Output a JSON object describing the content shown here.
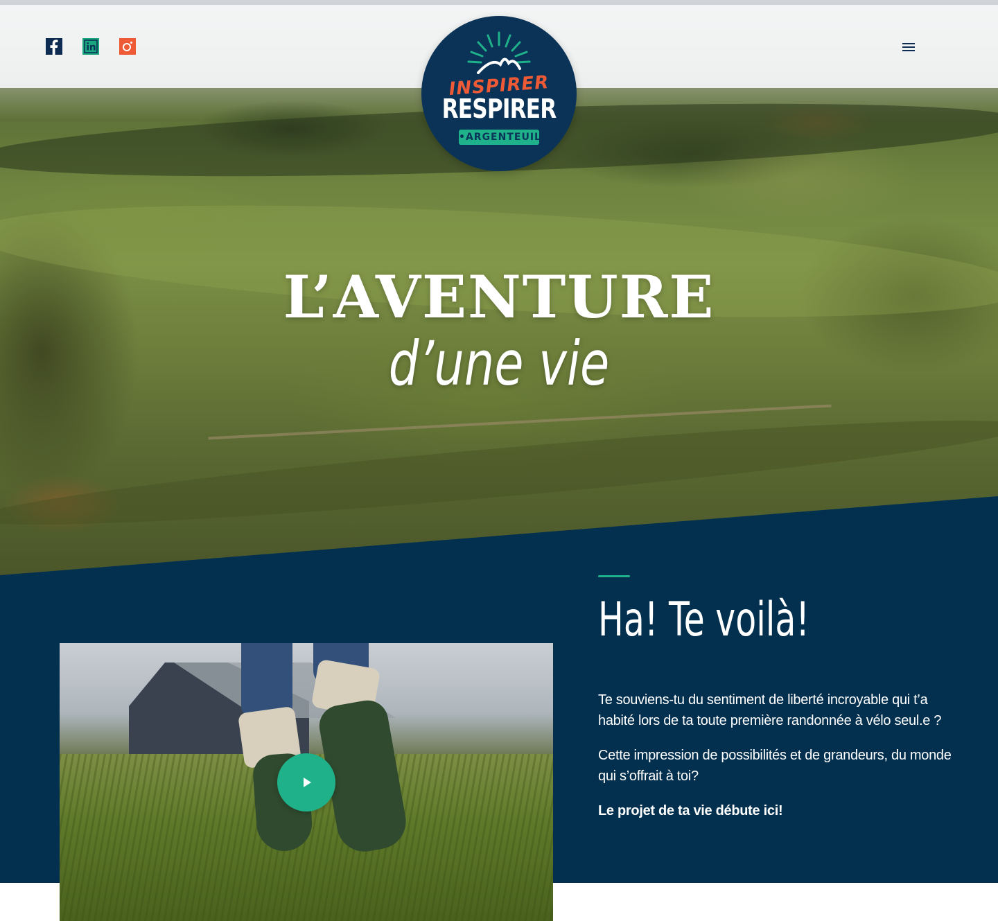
{
  "header": {
    "social": [
      {
        "name": "facebook",
        "icon": "facebook-icon"
      },
      {
        "name": "linkedin",
        "icon": "linkedin-icon"
      },
      {
        "name": "instagram",
        "icon": "instagram-icon"
      }
    ],
    "menu_icon": "hamburger-menu-icon"
  },
  "logo": {
    "line1": "INSPIRER",
    "line2": "RESPIRER",
    "badge": "•ARGENTEUIL•"
  },
  "hero": {
    "title": "L’AVENTURE",
    "subtitle": "d’une vie"
  },
  "intro": {
    "heading": "Ha! Te voilà!",
    "paragraph1": "Te souviens-tu du sentiment de liberté incroyable qui t’a habité lors de ta toute première randonnée à vélo seul.e ?",
    "paragraph2": "Cette impression de possibilités et de grandeurs, du monde qui s’offrait à toi?",
    "paragraph3": "Le projet de ta vie débute ici!"
  },
  "video": {
    "play_icon": "play-icon"
  },
  "colors": {
    "navy": "#03304f",
    "green": "#1fb28a",
    "orange": "#ee5a35"
  }
}
